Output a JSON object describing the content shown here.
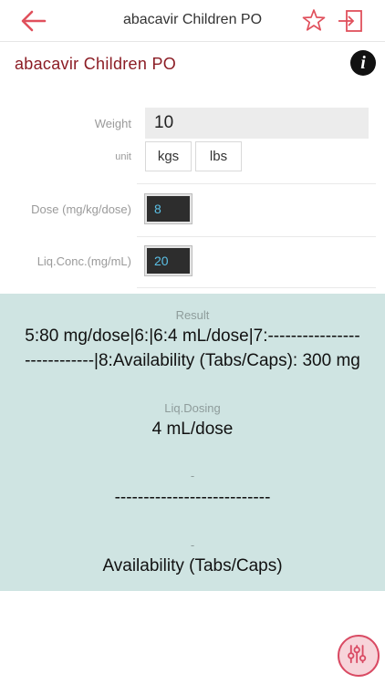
{
  "nav": {
    "title": "abacavir Children PO",
    "back_icon": "arrow-left-icon",
    "favorite_icon": "star-icon",
    "exit_icon": "exit-icon",
    "accent": "#e0505c"
  },
  "drug": {
    "name": "abacavir Children PO",
    "name_color": "#8b1c24",
    "info_icon": "info-icon"
  },
  "form": {
    "weight": {
      "label": "Weight",
      "value": "10"
    },
    "unit": {
      "label": "unit",
      "options": [
        "kgs",
        "lbs"
      ]
    },
    "dose": {
      "label": "Dose (mg/kg/dose)",
      "value": "8"
    },
    "conc": {
      "label": "Liq.Conc.(mg/mL)",
      "value": "20"
    }
  },
  "result": {
    "label": "Result",
    "line1": "5:80 mg/dose|6:|6:4 mL/dose|7:----------------",
    "line2": "------------|8:Availability (Tabs/Caps): 300 mg",
    "liq_label": "Liq.Dosing",
    "liq_value": "4 mL/dose",
    "dash_label": "-",
    "dash_value": "---------------------------",
    "avail_label": "-",
    "avail_value": "Availability (Tabs/Caps)",
    "panel_color": "#cfe4e2"
  },
  "fab": {
    "icon": "sliders-icon",
    "color": "#d94a63"
  }
}
